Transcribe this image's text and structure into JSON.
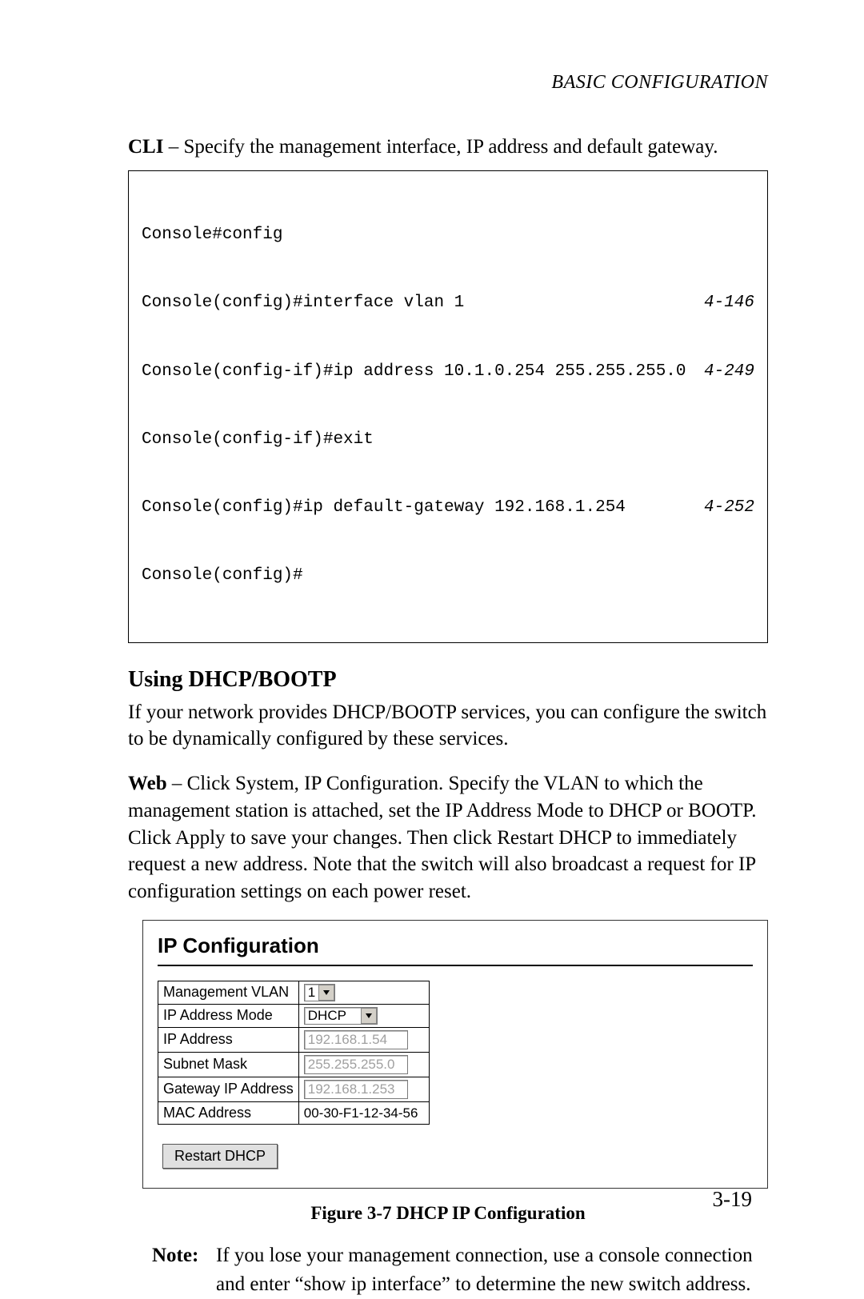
{
  "running_head": "BASIC CONFIGURATION",
  "cli_intro_bold": "CLI",
  "cli_intro_rest": " – Specify the management interface, IP address and default gateway.",
  "cli_lines": [
    {
      "cmd": "Console#config",
      "ref": ""
    },
    {
      "cmd": "Console(config)#interface vlan 1",
      "ref": "4-146"
    },
    {
      "cmd": "Console(config-if)#ip address 10.1.0.254 255.255.255.0",
      "ref": "4-249"
    },
    {
      "cmd": "Console(config-if)#exit",
      "ref": ""
    },
    {
      "cmd": "Console(config)#ip default-gateway 192.168.1.254",
      "ref": "4-252"
    },
    {
      "cmd": "Console(config)#",
      "ref": ""
    }
  ],
  "section_heading": "Using DHCP/BOOTP",
  "dhcp_para1": "If your network provides DHCP/BOOTP services, you can configure the switch to be dynamically configured by these services.",
  "web_bold": "Web",
  "web_rest": " – Click System, IP Configuration. Specify the VLAN to which the management station is attached, set the IP Address Mode to DHCP or BOOTP. Click Apply to save your changes. Then click Restart DHCP to immediately request a new address. Note that the switch will also broadcast a request for IP configuration settings on each power reset.",
  "panel": {
    "title": "IP Configuration",
    "rows": {
      "mgmt_vlan_label": "Management VLAN",
      "mgmt_vlan_value": "1",
      "ip_mode_label": "IP Address Mode",
      "ip_mode_value": "DHCP",
      "ip_addr_label": "IP Address",
      "ip_addr_value": "192.168.1.54",
      "subnet_label": "Subnet Mask",
      "subnet_value": "255.255.255.0",
      "gateway_label": "Gateway IP Address",
      "gateway_value": "192.168.1.253",
      "mac_label": "MAC Address",
      "mac_value": "00-30-F1-12-34-56"
    },
    "button": "Restart DHCP"
  },
  "figure_caption": "Figure 3-7  DHCP IP Configuration",
  "note_label": "Note:",
  "note_body": "If you lose your management connection, use a console connection and enter “show ip interface” to determine the new switch address.",
  "page_number": "3-19"
}
